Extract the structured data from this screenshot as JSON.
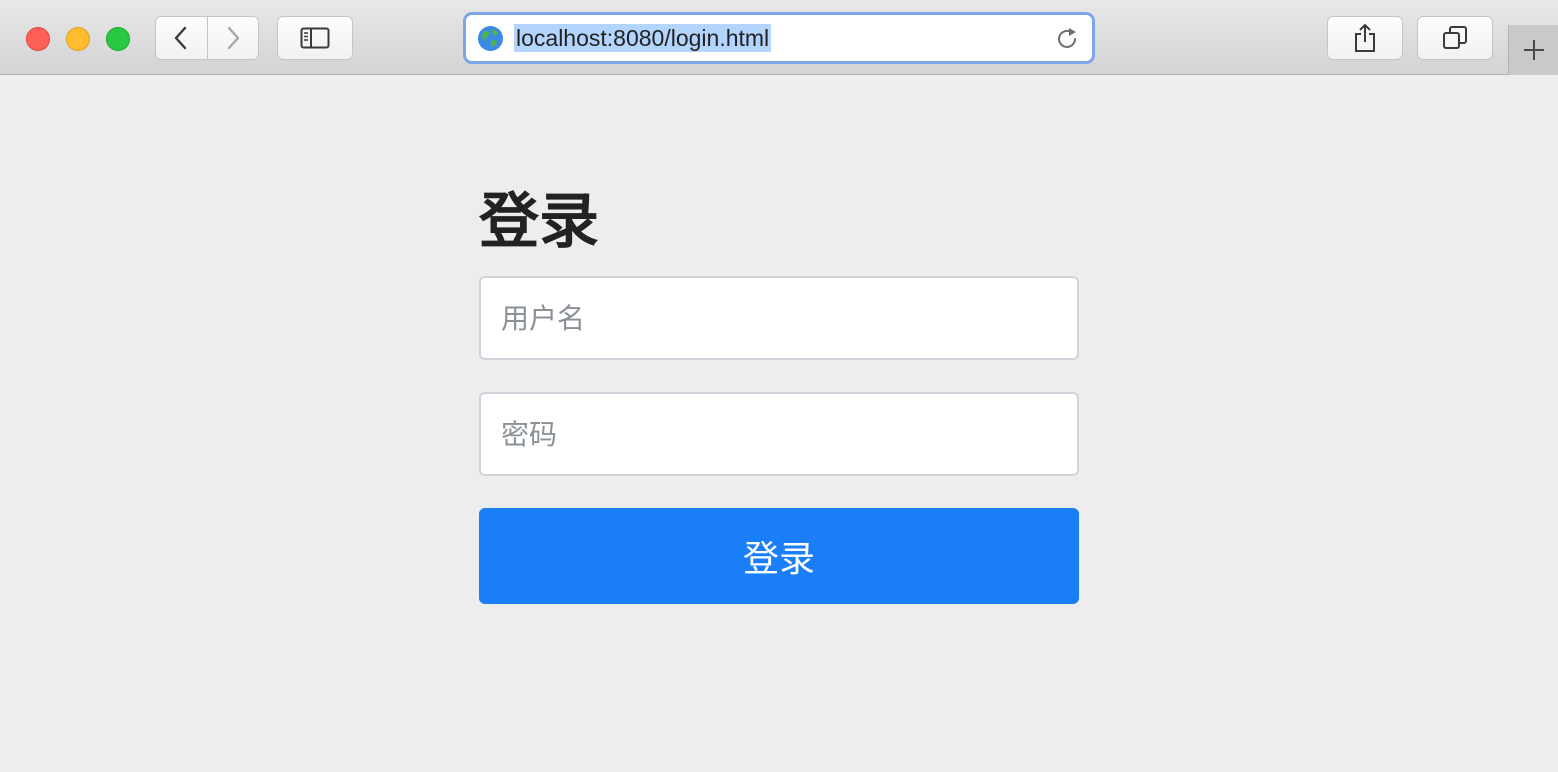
{
  "browser": {
    "url": "localhost:8080/login.html",
    "controls": {
      "close_color": "#fe5f57",
      "minimize_color": "#febc2e",
      "maximize_color": "#28c840"
    },
    "icons": {
      "back": "chevron-left-icon",
      "forward": "chevron-right-icon",
      "sidebar": "sidebar-icon",
      "site": "globe-icon",
      "reload": "reload-icon",
      "share": "share-icon",
      "tabs": "tabs-overview-icon",
      "new_tab": "plus-icon"
    }
  },
  "page": {
    "title": "登录",
    "username_placeholder": "用户名",
    "password_placeholder": "密码",
    "submit_label": "登录",
    "accent_color": "#1a7ef8"
  }
}
